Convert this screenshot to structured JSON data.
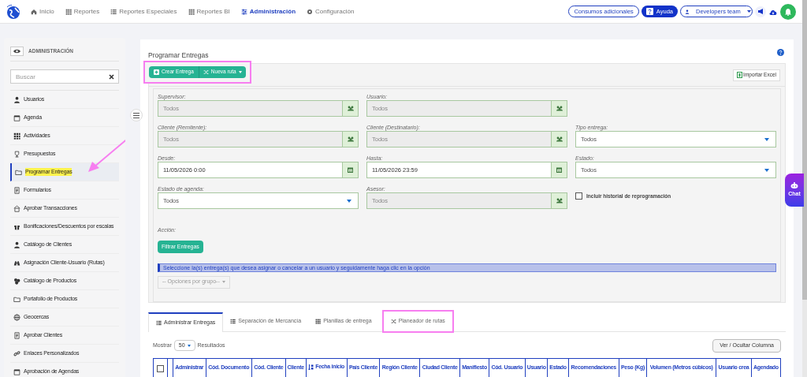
{
  "nav": {
    "items": [
      {
        "label": "Inicio",
        "selected": false
      },
      {
        "label": "Reportes",
        "selected": false
      },
      {
        "label": "Reportes Especiales",
        "selected": false
      },
      {
        "label": "Reportes BI",
        "selected": false
      },
      {
        "label": "Administración",
        "selected": true
      },
      {
        "label": "Configuración",
        "selected": false
      }
    ],
    "consumos": "Consumos adicionales",
    "ayuda": "Ayuda",
    "team": "Developers team"
  },
  "sidebar": {
    "title": "ADMINISTRACIÓN",
    "search_placeholder": "Buscar",
    "items": [
      {
        "label": "Usuarios",
        "selected": false,
        "highlighted": false
      },
      {
        "label": "Agenda",
        "selected": false,
        "highlighted": false
      },
      {
        "label": "Actividades",
        "selected": false,
        "highlighted": false
      },
      {
        "label": "Presupuestos",
        "selected": false,
        "highlighted": false
      },
      {
        "label": "Programar Entregas",
        "selected": true,
        "highlighted": true
      },
      {
        "label": "Formularios",
        "selected": false,
        "highlighted": false
      },
      {
        "label": "Aprobar Transacciones",
        "selected": false,
        "highlighted": false
      },
      {
        "label": "Bonificaciones/Descuentos por escalas",
        "selected": false,
        "highlighted": false
      },
      {
        "label": "Catálogo de Clientes",
        "selected": false,
        "highlighted": false
      },
      {
        "label": "Asignación Cliente-Usuario (Rutas)",
        "selected": false,
        "highlighted": false
      },
      {
        "label": "Catálogo de Productos",
        "selected": false,
        "highlighted": false
      },
      {
        "label": "Portafolio de Productos",
        "selected": false,
        "highlighted": false
      },
      {
        "label": "Geocercas",
        "selected": false,
        "highlighted": false
      },
      {
        "label": "Aprobar Clientes",
        "selected": false,
        "highlighted": false
      },
      {
        "label": "Enlaces Personalizados",
        "selected": false,
        "highlighted": false
      },
      {
        "label": "Aprobación de Agendas",
        "selected": false,
        "highlighted": false
      }
    ]
  },
  "page": {
    "title": "Programar Entregas",
    "toolbar_highlighted": true,
    "create_button": "Crear Entrega",
    "route_button": "Nueva ruta",
    "import_button": "Importar Excel",
    "filter_rows": [
      [
        {
          "kind": "lookup",
          "label": "Supervisor:",
          "value": "Todos"
        },
        {
          "kind": "lookup",
          "label": "Usuario:",
          "value": "Todos"
        },
        {
          "kind": "blank"
        }
      ],
      [
        {
          "kind": "lookup",
          "label": "Cliente (Remitente):",
          "value": "Todos"
        },
        {
          "kind": "lookup",
          "label": "Cliente (Destinatario):",
          "value": "Todos"
        },
        {
          "kind": "select",
          "label": "Tipo entrega:",
          "value": "Todos"
        }
      ],
      [
        {
          "kind": "date",
          "label": "Desde:",
          "value": "11/05/2026 0:00"
        },
        {
          "kind": "date",
          "label": "Hasta:",
          "value": "11/05/2026 23:59"
        },
        {
          "kind": "select",
          "label": "Estado:",
          "value": "Todos"
        }
      ],
      [
        {
          "kind": "select",
          "label": "Estado de agenda:",
          "value": "Todos"
        },
        {
          "kind": "lookup",
          "label": "Asesor:",
          "value": "Todos"
        },
        {
          "kind": "checkbox",
          "label": "Incluir historial de reprogramación",
          "checked": false
        }
      ]
    ],
    "action_label": "Acción:",
    "filter_button": "Filtrar Entregas",
    "info": "Seleccione la(s) entrega(s) que desea asignar o cancelar a un usuario y seguidamente haga clic en la opción",
    "group_options": "-- Opciones por grupo--",
    "tabs": [
      {
        "label": "Administrar Entregas",
        "selected": true,
        "highlighted": false
      },
      {
        "label": "Separación de Mercancía",
        "selected": false,
        "highlighted": false
      },
      {
        "label": "Planillas de entrega",
        "selected": false,
        "highlighted": false
      },
      {
        "label": "Planeador de rutas",
        "selected": false,
        "highlighted": true
      }
    ],
    "show_label": "Mostrar",
    "page_size": "50",
    "results_label": "Resultados",
    "columns_button": "Ver / Ocultar Columna",
    "columns": [
      "Administrar",
      "Cód. Documento",
      "Cód. Cliente",
      "Cliente",
      "Fecha inicio",
      "País Cliente",
      "Región Cliente",
      "Ciudad Cliente",
      "Manifiesto",
      "Cód. Usuario",
      "Usuario",
      "Estado",
      "Recomendaciones",
      "Peso (Kg)",
      "Volumen (Metros cúbicos)",
      "Usuario crea",
      "Agendado"
    ],
    "select_all_checked": false
  },
  "chat": "Chat"
}
